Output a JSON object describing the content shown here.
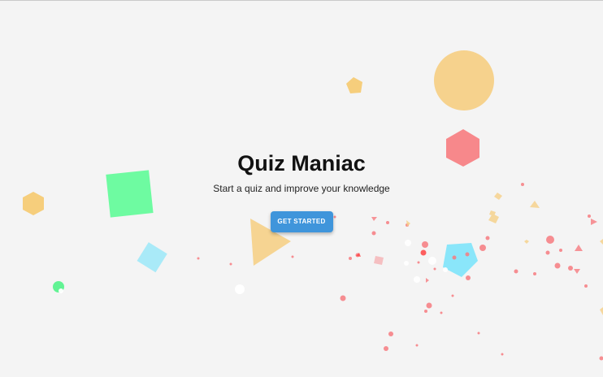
{
  "app": {
    "title": "Quiz Maniac",
    "subtitle": "Start a quiz and improve your knowledge",
    "cta_label": "GET STARTED"
  },
  "colors": {
    "background": "#f4f4f4",
    "accent": "#3f95db",
    "title_text": "#121212",
    "confetti": [
      "#f6cf7e",
      "#f77c80",
      "#5ffc98",
      "#9be8f8",
      "#7ee4fb",
      "#fcfcfc",
      "#f6a0a5"
    ]
  }
}
